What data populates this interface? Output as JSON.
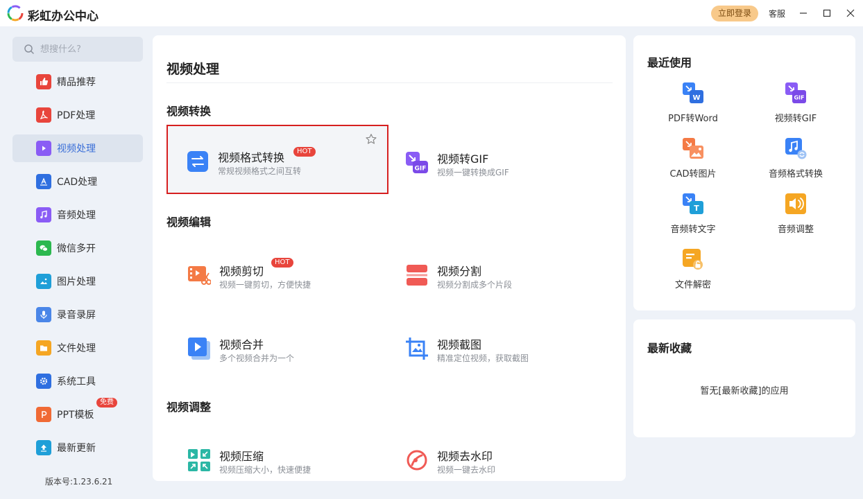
{
  "app": {
    "title": "彩虹办公中心"
  },
  "titlebar": {
    "login": "立即登录",
    "service": "客服"
  },
  "search": {
    "placeholder": "想搜什么?"
  },
  "sidebar": {
    "items": [
      {
        "label": "精品推荐",
        "icon": "thumbs-up-icon",
        "color": "#e8453c"
      },
      {
        "label": "PDF处理",
        "icon": "pdf-icon",
        "color": "#e8453c"
      },
      {
        "label": "视频处理",
        "icon": "video-play-icon",
        "color": "#8a5cf5",
        "active": true
      },
      {
        "label": "CAD处理",
        "icon": "cad-icon",
        "color": "#2f6fe0"
      },
      {
        "label": "音频处理",
        "icon": "music-icon",
        "color": "#8a5cf5"
      },
      {
        "label": "微信多开",
        "icon": "wechat-icon",
        "color": "#2cb84f"
      },
      {
        "label": "图片处理",
        "icon": "image-icon",
        "color": "#1f9fd8"
      },
      {
        "label": "录音录屏",
        "icon": "microphone-icon",
        "color": "#4a86e8"
      },
      {
        "label": "文件处理",
        "icon": "folder-icon",
        "color": "#f5a623"
      },
      {
        "label": "系统工具",
        "icon": "gear-icon",
        "color": "#2f6fe0"
      },
      {
        "label": "PPT模板",
        "icon": "ppt-icon",
        "color": "#f06a35",
        "badge": "免费"
      },
      {
        "label": "最新更新",
        "icon": "upload-icon",
        "color": "#1f9fd8"
      }
    ]
  },
  "version": "版本号:1.23.6.21",
  "main": {
    "title": "视频处理",
    "sections": [
      {
        "title": "视频转换"
      },
      {
        "title": "视频编辑"
      },
      {
        "title": "视频调整"
      }
    ],
    "tools": [
      {
        "name": "视频格式转换",
        "desc": "常规视频格式之间互转",
        "hot": "HOT",
        "icon": "convert-arrows-icon"
      },
      {
        "name": "视频转GIF",
        "desc": "视频一键转换成GIF",
        "icon": "video-to-gif-icon"
      },
      {
        "name": "视频剪切",
        "desc": "视频一键剪切，方便快捷",
        "hot": "HOT",
        "icon": "video-cut-icon"
      },
      {
        "name": "视频分割",
        "desc": "视频分割成多个片段",
        "icon": "video-split-icon"
      },
      {
        "name": "视频合并",
        "desc": "多个视频合并为一个",
        "icon": "video-merge-icon"
      },
      {
        "name": "视频截图",
        "desc": "精准定位视频，获取截图",
        "icon": "crop-image-icon"
      },
      {
        "name": "视频压缩",
        "desc": "视频压缩大小，快速便捷",
        "icon": "compress-icon"
      },
      {
        "name": "视频去水印",
        "desc": "视频一键去水印",
        "icon": "watermark-remove-icon"
      }
    ]
  },
  "recent": {
    "title": "最近使用",
    "items": [
      {
        "label": "PDF转Word",
        "icon": "pdf-to-word-icon"
      },
      {
        "label": "视频转GIF",
        "icon": "video-to-gif-icon"
      },
      {
        "label": "CAD转图片",
        "icon": "cad-to-image-icon"
      },
      {
        "label": "音频格式转换",
        "icon": "audio-convert-icon"
      },
      {
        "label": "音频转文字",
        "icon": "audio-to-text-icon"
      },
      {
        "label": "音频调整",
        "icon": "volume-icon"
      },
      {
        "label": "文件解密",
        "icon": "file-decrypt-icon"
      }
    ]
  },
  "favorites": {
    "title": "最新收藏",
    "empty": "暂无[最新收藏]的应用"
  }
}
